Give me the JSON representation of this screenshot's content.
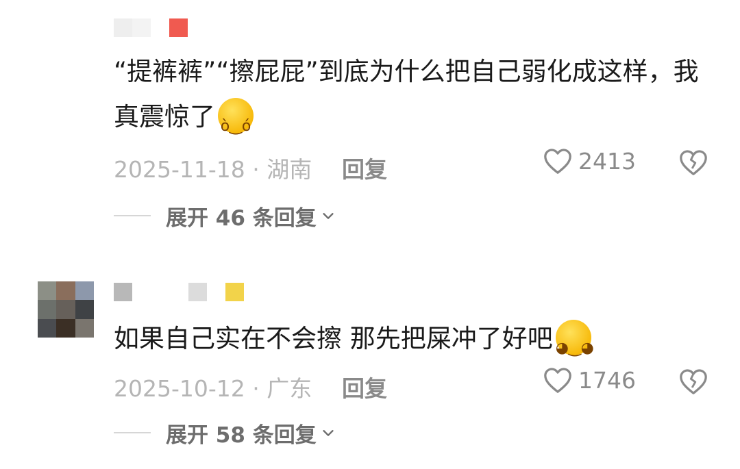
{
  "comments": [
    {
      "text": "“提裤裤”“擦屁屁”到底为什么把自己弱化成这样，我真震惊了",
      "emoji_icon": "shocked-face-emoji",
      "date_location": "2025-11-18 · 湖南",
      "reply_label": "回复",
      "like_count": "2413",
      "expand_label": "展开 46 条回复"
    },
    {
      "text": "如果自己实在不会擦 那先把屎冲了好吧",
      "emoji_icon": "smiling-face-emoji",
      "date_location": "2025-10-12 · 广东",
      "reply_label": "回复",
      "like_count": "1746",
      "expand_label": "展开 58 条回复"
    }
  ],
  "icons": {
    "like": "heart-outline-icon",
    "dislike": "broken-heart-icon",
    "expand": "chevron-down-icon"
  },
  "colors": {
    "text": "#1a1a1a",
    "meta": "#b5b5b5",
    "action": "#8a8a8a"
  }
}
